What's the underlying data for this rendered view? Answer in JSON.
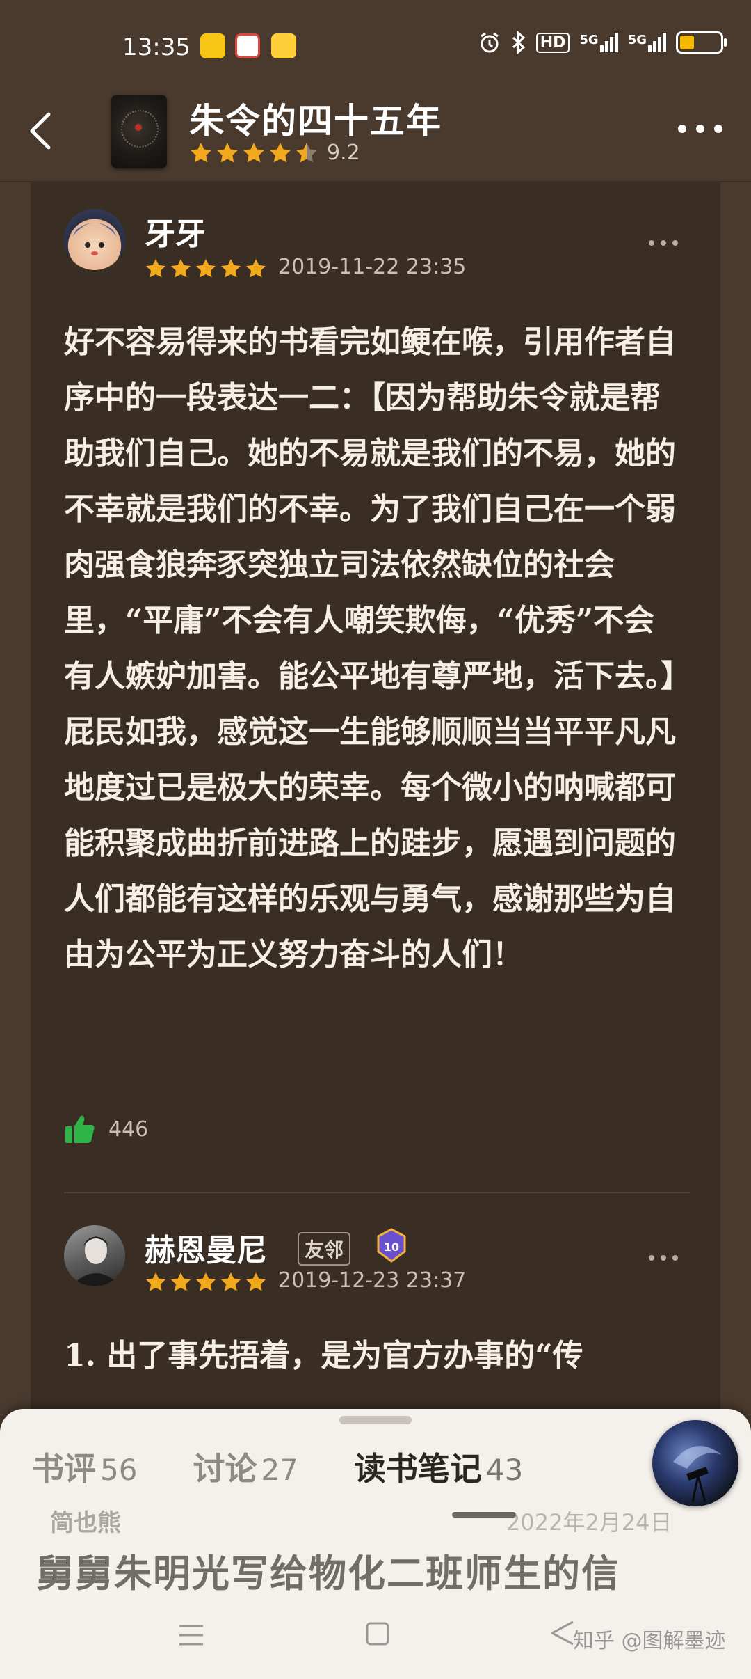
{
  "status_bar": {
    "time": "13:35",
    "icons": [
      "alarm-icon",
      "bluetooth-icon",
      "hd-icon",
      "signal-5g-icon",
      "signal-5g-icon",
      "battery-icon"
    ],
    "hd_label": "HD",
    "net1": "5G",
    "net2": "5G",
    "battery_level": 0.35
  },
  "header": {
    "book_title": "朱令的四十五年",
    "rating_score": "9.2",
    "rating_stars": 4.5
  },
  "reviews": [
    {
      "user": "牙牙",
      "date": "2019-11-22 23:35",
      "stars": 5,
      "body": "好不容易得来的书看完如鲠在喉，引用作者自序中的一段表达一二：【因为帮助朱令就是帮助我们自己。她的不易就是我们的不易，她的不幸就是我们的不幸。为了我们自己在一个弱肉强食狼奔豕突独立司法依然缺位的社会里，“平庸”不会有人嘲笑欺侮，“优秀”不会有人嫉妒加害。能公平地有尊严地，活下去。】屁民如我，感觉这一生能够顺顺当当平平凡凡地度过已是极大的荣幸。每个微小的呐喊都可能积聚成曲折前进路上的跬步，愿遇到问题的人们都能有这样的乐观与勇气，感谢那些为自由为公平为正义努力奋斗的人们！",
      "likes": "446"
    },
    {
      "user": "赫恩曼尼",
      "badge": "友邻",
      "level": "10",
      "date": "2019-12-23 23:37",
      "stars": 5,
      "body": "1. 出了事先捂着，是为官方办事的“传"
    }
  ],
  "sheet": {
    "tabs": [
      {
        "label": "书评",
        "count": "56"
      },
      {
        "label": "讨论",
        "count": "27"
      },
      {
        "label": "读书笔记",
        "count": "43"
      }
    ],
    "active_tab": 2,
    "peek_user": "简也熊",
    "peek_date": "2022年2月24日",
    "peek_title": "舅舅朱明光写给物化二班师生的信"
  },
  "watermark": "知乎 @图解墨迹",
  "colors": {
    "background": "#4a3a2e",
    "panel": "#3a2d24",
    "star": "#f2a91d",
    "like": "#2fb44a"
  }
}
